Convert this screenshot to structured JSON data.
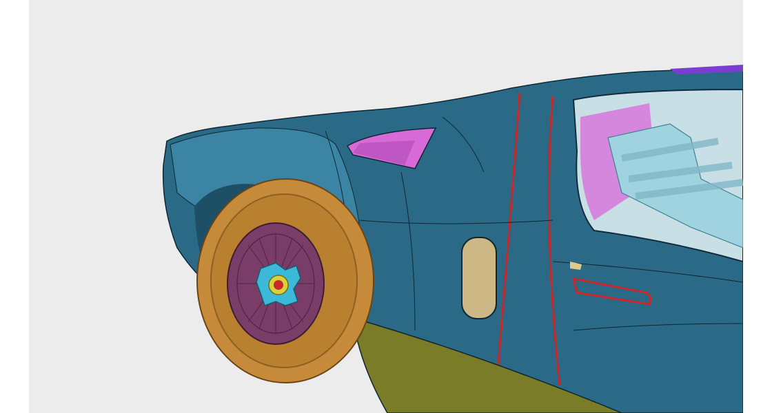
{
  "scene": {
    "subject": "cad-render-race-car-side",
    "colors": {
      "background": "#ececec",
      "margin": "#ffffff",
      "body": "#2b6a87",
      "body_light": "#3b84a4",
      "body_dark": "#1d4f66",
      "edge": "#0d2632",
      "seam": "#c8282a",
      "glass": "#d9ecf1",
      "intake": "#d86ad8",
      "engine": "#9fd3e0",
      "tire": "#c58a3a",
      "tire_dark": "#8f5f22",
      "rim": "#7a3d68",
      "hub": "#3cb8d8",
      "sill": "#7b7c28",
      "door_handle": "#e1c88b",
      "lamp": "#cdb784"
    }
  }
}
